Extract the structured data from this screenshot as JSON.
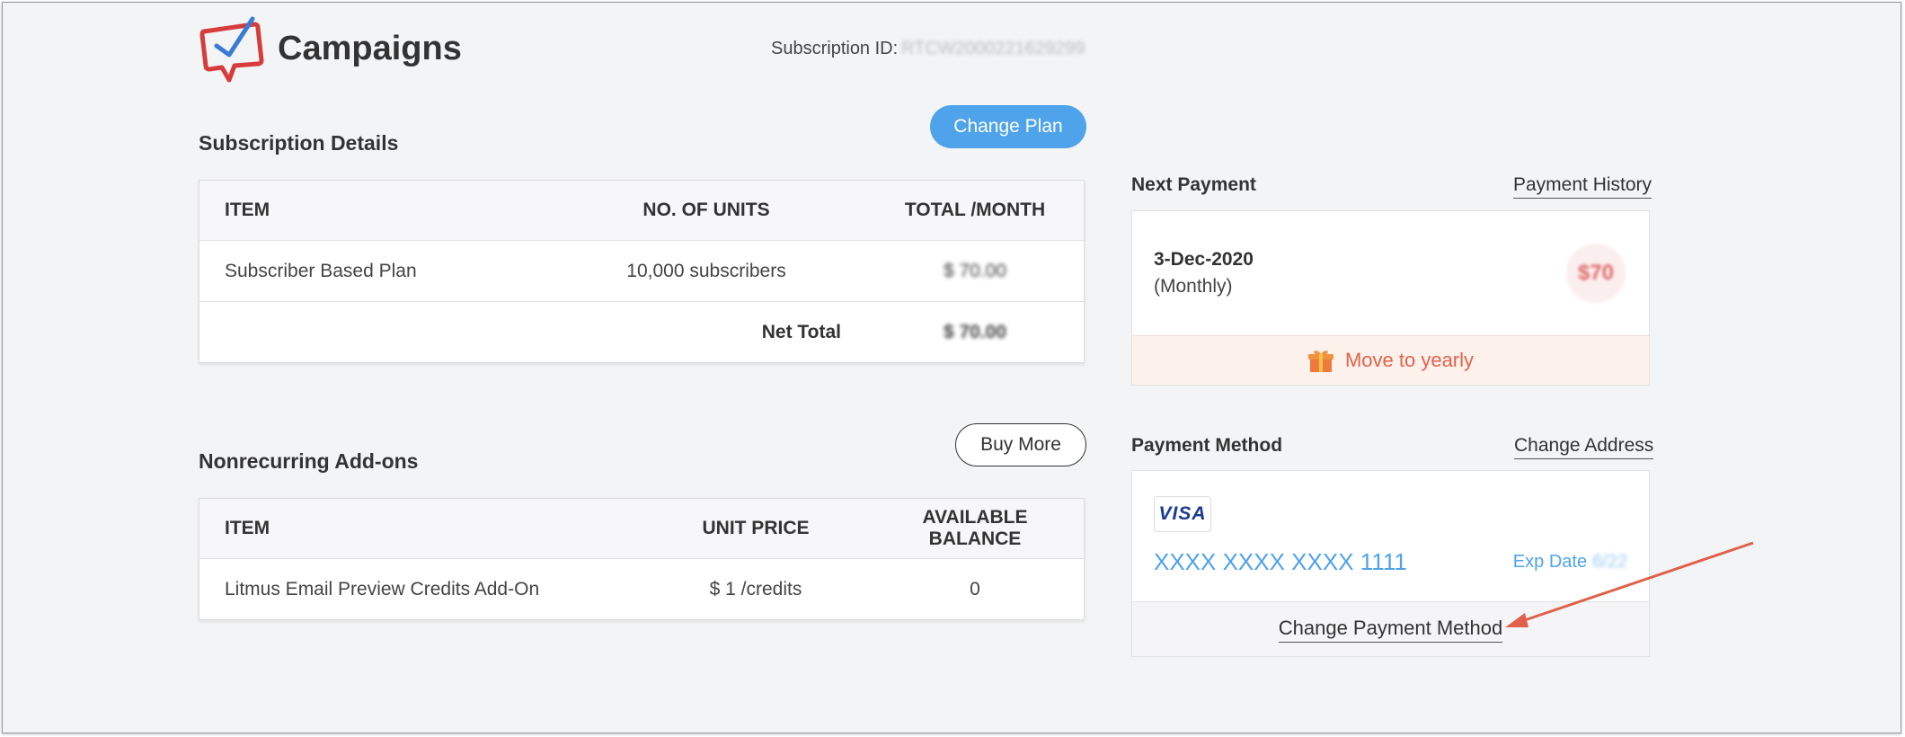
{
  "app": {
    "title": "Campaigns",
    "subscription_id_label": "Subscription ID:",
    "subscription_id_value": "RTCW2000221629299"
  },
  "subscription": {
    "title": "Subscription Details",
    "change_plan_label": "Change Plan",
    "headers": [
      "ITEM",
      "NO. OF UNITS",
      "TOTAL /MONTH"
    ],
    "rows": [
      {
        "item": "Subscriber Based Plan",
        "units": "10,000 subscribers",
        "total": "$ 70.00"
      }
    ],
    "net_total_label": "Net Total",
    "net_total_value": "$ 70.00"
  },
  "addons": {
    "title": "Nonrecurring Add-ons",
    "buy_more_label": "Buy More",
    "headers": [
      "ITEM",
      "UNIT PRICE",
      "AVAILABLE BALANCE"
    ],
    "rows": [
      {
        "item": "Litmus Email Preview Credits Add-On",
        "unit_price": "$ 1 /credits",
        "balance": "0"
      }
    ]
  },
  "next_payment": {
    "label": "Next Payment",
    "history_link": "Payment History",
    "date": "3-Dec-2020",
    "period": "(Monthly)",
    "amount": "$70",
    "move_to_yearly": "Move to yearly"
  },
  "payment_method": {
    "label": "Payment Method",
    "change_address": "Change Address",
    "card_brand": "VISA",
    "card_number": "XXXX XXXX XXXX 1111",
    "exp_label": "Exp Date",
    "exp_value": "6/22",
    "change_payment_method": "Change Payment Method"
  },
  "colors": {
    "accent": "#4ea3ea",
    "warning_text": "#e3624b",
    "annotation_arrow": "#e0604a"
  }
}
